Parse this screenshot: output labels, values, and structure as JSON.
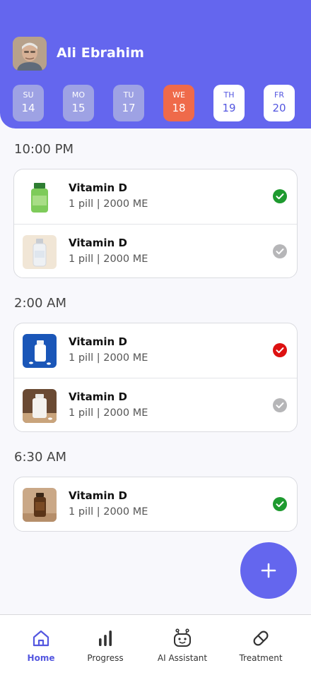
{
  "user": {
    "name": "Ali Ebrahim"
  },
  "days": [
    {
      "name": "SU",
      "date": "14",
      "state": "past"
    },
    {
      "name": "MO",
      "date": "15",
      "state": "past"
    },
    {
      "name": "TU",
      "date": "17",
      "state": "past"
    },
    {
      "name": "WE",
      "date": "18",
      "state": "today"
    },
    {
      "name": "TH",
      "date": "19",
      "state": "future"
    },
    {
      "name": "FR",
      "date": "20",
      "state": "future"
    }
  ],
  "schedule": [
    {
      "time": "10:00 PM",
      "meds": [
        {
          "name": "Vitamin D",
          "dose": "1 pill | 2000 ME",
          "status": "taken",
          "image": "green-supplement-bottle"
        },
        {
          "name": "Vitamin D",
          "dose": "1 pill | 2000 ME",
          "status": "pending",
          "image": "glass-vial"
        }
      ]
    },
    {
      "time": "2:00 AM",
      "meds": [
        {
          "name": "Vitamin D",
          "dose": "1 pill | 2000 ME",
          "status": "missed",
          "image": "white-bottle-blue-background"
        },
        {
          "name": "Vitamin D",
          "dose": "1 pill | 2000 ME",
          "status": "pending",
          "image": "white-bottle-brown-background"
        }
      ]
    },
    {
      "time": "6:30 AM",
      "meds": [
        {
          "name": "Vitamin D",
          "dose": "1 pill | 2000 ME",
          "status": "taken",
          "image": "amber-bottle"
        }
      ]
    }
  ],
  "nav": [
    {
      "label": "Home",
      "icon": "home-icon",
      "active": true
    },
    {
      "label": "Progress",
      "icon": "bar-chart-icon",
      "active": false
    },
    {
      "label": "AI Assistant",
      "icon": "robot-icon",
      "active": false
    },
    {
      "label": "Treatment",
      "icon": "pill-icon",
      "active": false
    }
  ],
  "colors": {
    "primary": "#6466ee",
    "today": "#ef6a4a",
    "taken": "#1e9a2f",
    "missed": "#dd1111",
    "pending": "#b6b6b8"
  }
}
